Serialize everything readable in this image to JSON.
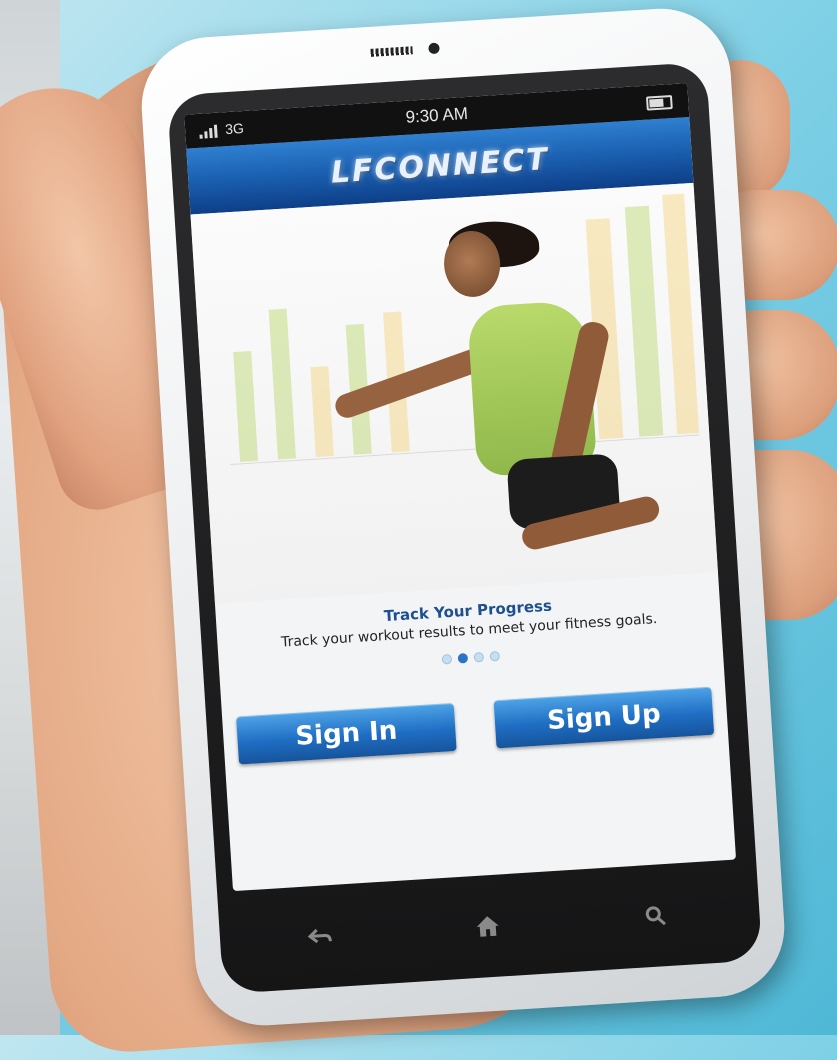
{
  "status_bar": {
    "network": "3G",
    "time": "9:30 AM"
  },
  "app": {
    "logo": "LFCONNECT"
  },
  "caption": {
    "title": "Track Your Progress",
    "text": "Track your workout results to meet your fitness goals."
  },
  "pager": {
    "total": 4,
    "active_index": 1
  },
  "buttons": {
    "sign_in": "Sign In",
    "sign_up": "Sign Up"
  },
  "nav": {
    "back_icon": "back-icon",
    "home_icon": "home-icon",
    "search_icon": "search-icon"
  },
  "colors": {
    "header_blue": "#1a5fb0",
    "button_blue": "#1f6ec4",
    "caption_title": "#1d4f91",
    "bar_green": "#b9d76a",
    "bar_yellow": "#f3d27a"
  }
}
